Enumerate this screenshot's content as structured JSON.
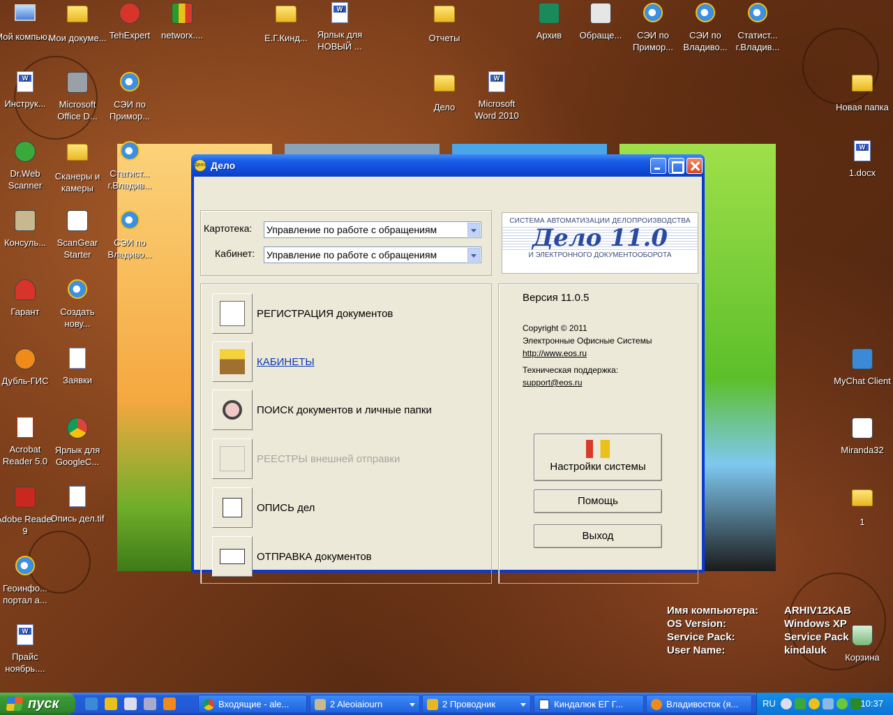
{
  "desktop": {
    "icons": [
      {
        "id": "my-computer",
        "label": "Мой компью..."
      },
      {
        "id": "my-documents",
        "label": "Мои докуме..."
      },
      {
        "id": "tehexpert",
        "label": "TehExpert"
      },
      {
        "id": "networx",
        "label": "networx...."
      },
      {
        "id": "eg-kind",
        "label": "Е.Г.Кинд..."
      },
      {
        "id": "shortcut-new",
        "label": "Ярлык для НОВЫЙ ..."
      },
      {
        "id": "reports",
        "label": "Отчеты"
      },
      {
        "id": "archive",
        "label": "Архив"
      },
      {
        "id": "obrasche",
        "label": "Обраще..."
      },
      {
        "id": "sei-prim-top",
        "label": "СЭИ по Примор..."
      },
      {
        "id": "sei-vlad-top",
        "label": "СЭИ по Владиво..."
      },
      {
        "id": "statist-top",
        "label": "Статист... г.Владив..."
      },
      {
        "id": "instruk",
        "label": "Инструк..."
      },
      {
        "id": "ms-office-doc",
        "label": "Microsoft Office D..."
      },
      {
        "id": "sei-prim-2",
        "label": "СЭИ по Примор..."
      },
      {
        "id": "delo",
        "label": "Дело"
      },
      {
        "id": "word-2010",
        "label": "Microsoft Word 2010"
      },
      {
        "id": "new-folder",
        "label": "Новая папка"
      },
      {
        "id": "drweb",
        "label": "Dr.Web Scanner"
      },
      {
        "id": "scanners",
        "label": "Сканеры и камеры"
      },
      {
        "id": "statist-2",
        "label": "Статист... г.Владив..."
      },
      {
        "id": "docx",
        "label": "1.docx"
      },
      {
        "id": "konsul",
        "label": "Консуль..."
      },
      {
        "id": "scangear",
        "label": "ScanGear Starter"
      },
      {
        "id": "sei-vlad-2",
        "label": "СЭИ по Владиво..."
      },
      {
        "id": "garant",
        "label": "Гарант"
      },
      {
        "id": "create-new",
        "label": "Создать нову..."
      },
      {
        "id": "dubl-gis",
        "label": "Дубль-ГИС"
      },
      {
        "id": "zayavki",
        "label": "Заявки"
      },
      {
        "id": "mychat",
        "label": "MyChat Client"
      },
      {
        "id": "acrobat5",
        "label": "Acrobat Reader 5.0"
      },
      {
        "id": "chrome-shortcut",
        "label": "Ярлык для GoogleC..."
      },
      {
        "id": "miranda",
        "label": "Miranda32"
      },
      {
        "id": "adobe9",
        "label": "Adobe Reader 9"
      },
      {
        "id": "opis-tif",
        "label": "Опись дел.tif"
      },
      {
        "id": "folder-1",
        "label": "1"
      },
      {
        "id": "geoinfo",
        "label": "Геоинфо... портал а..."
      },
      {
        "id": "prais",
        "label": "Прайс ноябрь...."
      },
      {
        "id": "recycle",
        "label": "Корзина"
      }
    ]
  },
  "window": {
    "title": "Дело",
    "icon_text": "Дело",
    "kartoteka_label": "Картотека:",
    "kartoteka_value": "Управление по работе с обращениям",
    "kabinet_label": "Кабинет:",
    "kabinet_value": "Управление по работе с обращениям",
    "logo": {
      "top": "СИСТЕМА АВТОМАТИЗАЦИИ ДЕЛОПРОИЗВОДСТВА",
      "mid": "Дело 11.0",
      "bot": "И ЭЛЕКТРОННОГО ДОКУМЕНТООБОРОТА"
    },
    "menu": [
      {
        "label": "РЕГИСТРАЦИЯ  документов",
        "state": "normal"
      },
      {
        "label": "КАБИНЕТЫ",
        "state": "link"
      },
      {
        "label": "ПОИСК  документов и личные папки",
        "state": "normal"
      },
      {
        "label": "РЕЕСТРЫ  внешней отправки",
        "state": "disabled"
      },
      {
        "label": "ОПИСЬ дел",
        "state": "normal"
      },
      {
        "label": "ОТПРАВКА документов",
        "state": "normal"
      }
    ],
    "version": "Версия 11.0.5",
    "copyright": "Copyright © 2011",
    "company": "Электронные Офисные Системы",
    "website": "http://www.eos.ru",
    "support_label": "Техническая поддержка:",
    "support_email": "support@eos.ru",
    "settings_button": "Настройки системы",
    "help_button": "Помощь",
    "exit_button": "Выход"
  },
  "sysinfo": {
    "computer_name_label": "Имя компьютера:",
    "computer_name": "ARHIV12KAB",
    "os_label": "OS Version:",
    "os": "Windows XP",
    "sp_label": "Service Pack:",
    "sp": "Service Pack",
    "user_label": "User Name:",
    "user": "kindaluk"
  },
  "taskbar": {
    "start": "пуск",
    "tasks": [
      {
        "label": "Входящие - ale..."
      },
      {
        "label": "2 Aleoiaiourn"
      },
      {
        "label": "2 Проводник"
      },
      {
        "label": "Киндалюк ЕГ Г..."
      },
      {
        "label": "Владивосток (я..."
      }
    ],
    "lang": "RU",
    "clock": "10:37"
  }
}
